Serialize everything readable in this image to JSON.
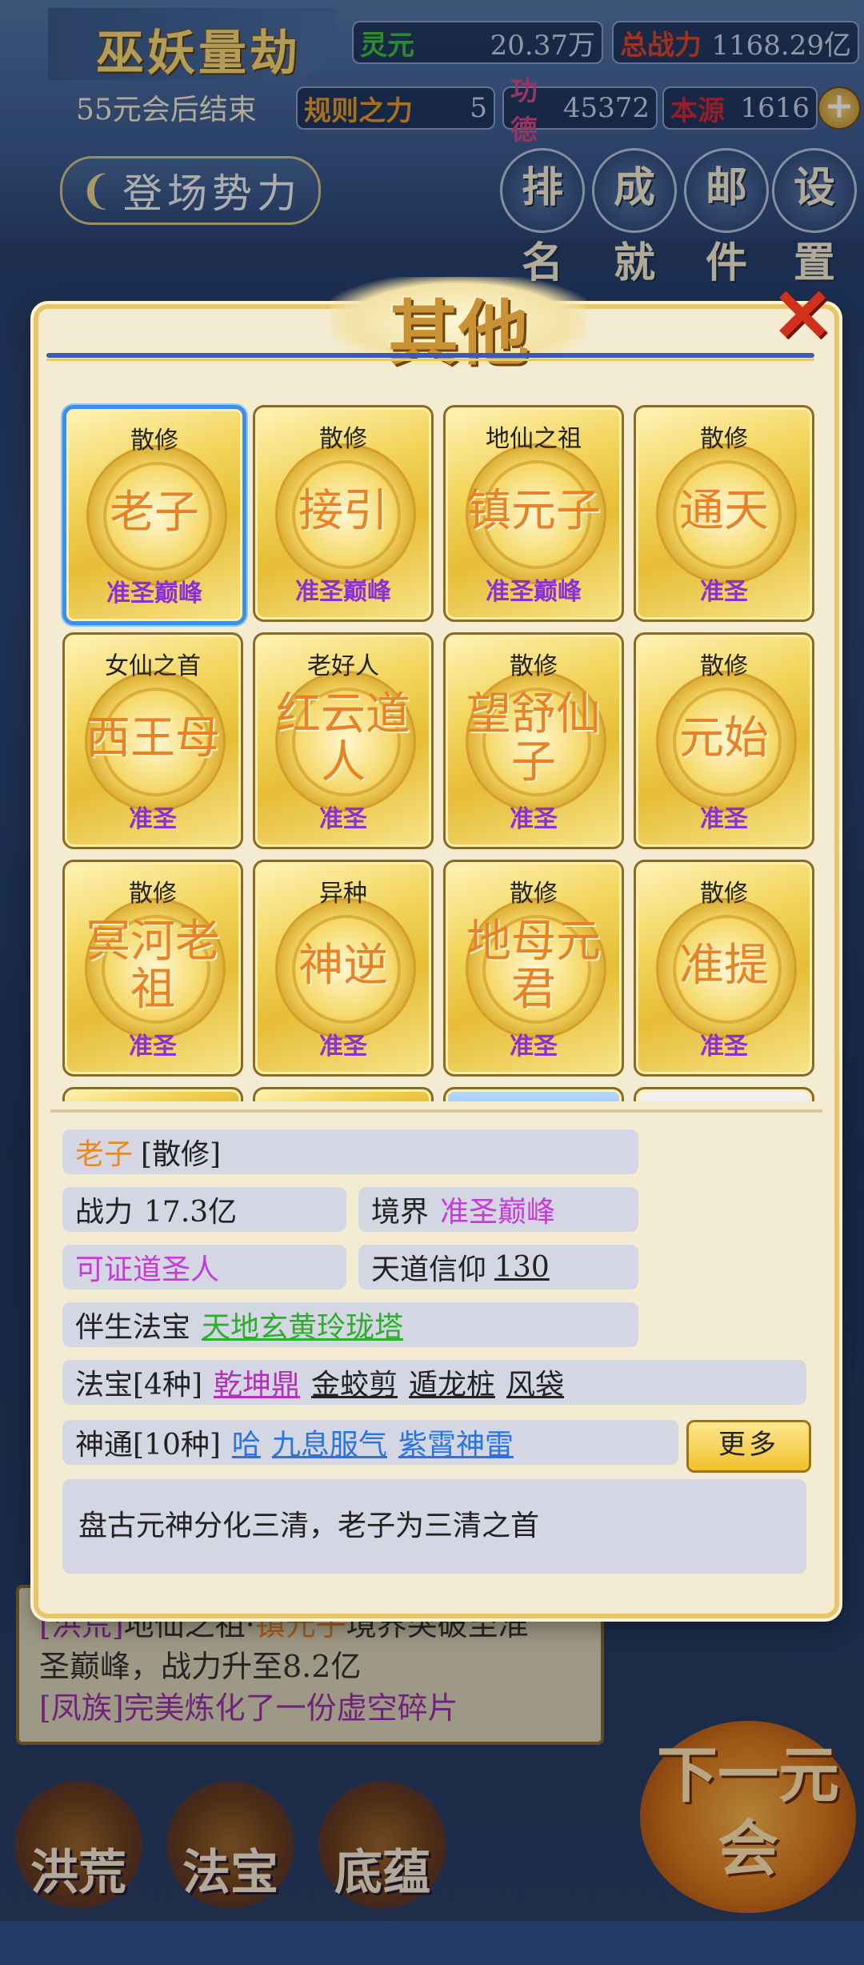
{
  "hud": {
    "game_title": "巫妖量劫",
    "era_text": "55元会后结束",
    "stats": {
      "lingyuan_label": "灵元",
      "lingyuan_value": "20.37万",
      "power_label": "总战力",
      "power_value": "1168.29亿",
      "rule_label": "规则之力",
      "rule_value": "5",
      "merit_label": "功德",
      "merit_value": "45372",
      "origin_label": "本源",
      "origin_value": "1616"
    },
    "faction_button": "登场势力",
    "nav": [
      "排名",
      "成就",
      "邮件",
      "设置"
    ]
  },
  "modal": {
    "title": "其他",
    "close": "✕",
    "cards": [
      {
        "faction": "散修",
        "name": "老子",
        "realm": "准圣巅峰"
      },
      {
        "faction": "散修",
        "name": "接引",
        "realm": "准圣巅峰"
      },
      {
        "faction": "地仙之祖",
        "name": "镇元子",
        "realm": "准圣巅峰"
      },
      {
        "faction": "散修",
        "name": "通天",
        "realm": "准圣"
      },
      {
        "faction": "女仙之首",
        "name": "西王母",
        "realm": "准圣"
      },
      {
        "faction": "老好人",
        "name": "红云道人",
        "realm": "准圣"
      },
      {
        "faction": "散修",
        "name": "望舒仙子",
        "realm": "准圣"
      },
      {
        "faction": "散修",
        "name": "元始",
        "realm": "准圣"
      },
      {
        "faction": "散修",
        "name": "冥河老祖",
        "realm": "准圣"
      },
      {
        "faction": "异种",
        "name": "神逆",
        "realm": "准圣"
      },
      {
        "faction": "散修",
        "name": "地母元君",
        "realm": "准圣"
      },
      {
        "faction": "散修",
        "name": "准提",
        "realm": "准圣"
      }
    ],
    "detail": {
      "name": "老子",
      "faction": "[散修]",
      "power_label": "战力",
      "power_value": "17.3亿",
      "realm_label": "境界",
      "realm_value": "准圣巅峰",
      "sainthood": "可证道圣人",
      "faith_label": "天道信仰",
      "faith_value": "130",
      "companion_label": "伴生法宝",
      "companion_value": "天地玄黄玲珑塔",
      "treasures_label": "法宝[4种]",
      "treasures": [
        "乾坤鼎",
        "金蛟剪",
        "遁龙桩",
        "风袋"
      ],
      "skills_label": "神通[10种]",
      "skills": [
        "哈",
        "九息服气",
        "紫霄神雷"
      ],
      "more": "更多",
      "description": "盘古元神分化三清，老子为三清之首"
    }
  },
  "log": {
    "line1_tag": "[洪荒]",
    "line1_mid": "地仙之祖·",
    "line1_name": "镇元子",
    "line1_rest": "境界突破至准",
    "line2": "圣巅峰，战力升至8.2亿",
    "line3": "[凤族]完美炼化了一份虚空碎片"
  },
  "bottom_nav": [
    "洪荒",
    "法宝",
    "底蕴"
  ],
  "next_button": "下一元会"
}
